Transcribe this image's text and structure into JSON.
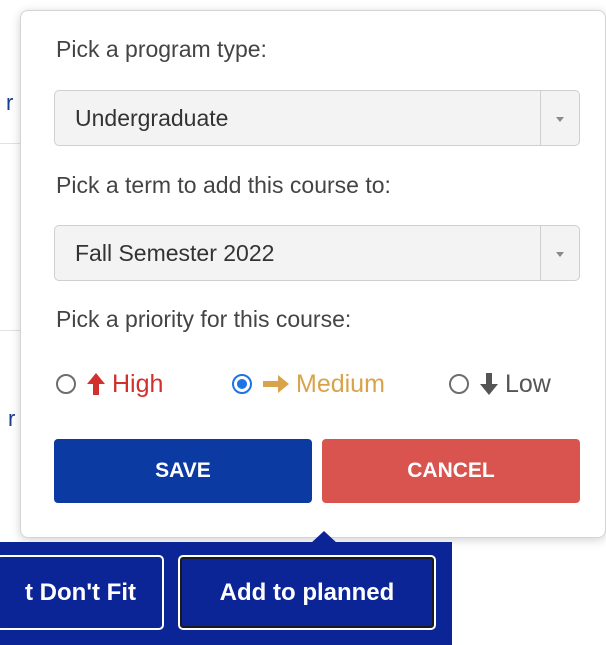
{
  "popover": {
    "program_label": "Pick a program type:",
    "program_value": "Undergraduate",
    "term_label": "Pick a term to add this course to:",
    "term_value": "Fall Semester 2022",
    "priority_label": "Pick a priority for this course:",
    "priorities": [
      {
        "label": "High",
        "icon": "arrow-up-icon",
        "color": "#d0312d",
        "selected": false
      },
      {
        "label": "Medium",
        "icon": "arrow-right-icon",
        "color": "#d8a34b",
        "selected": true
      },
      {
        "label": "Low",
        "icon": "arrow-down-icon",
        "color": "#555555",
        "selected": false
      }
    ],
    "save_label": "SAVE",
    "cancel_label": "CANCEL"
  },
  "bottom_bar": {
    "left_button_label": "t Don't Fit",
    "right_button_label": "Add to planned"
  },
  "colors": {
    "primary_blue": "#0b3aa3",
    "bar_blue": "#0c2596",
    "cancel_red": "#d9534f",
    "radio_blue": "#1e73e6"
  }
}
